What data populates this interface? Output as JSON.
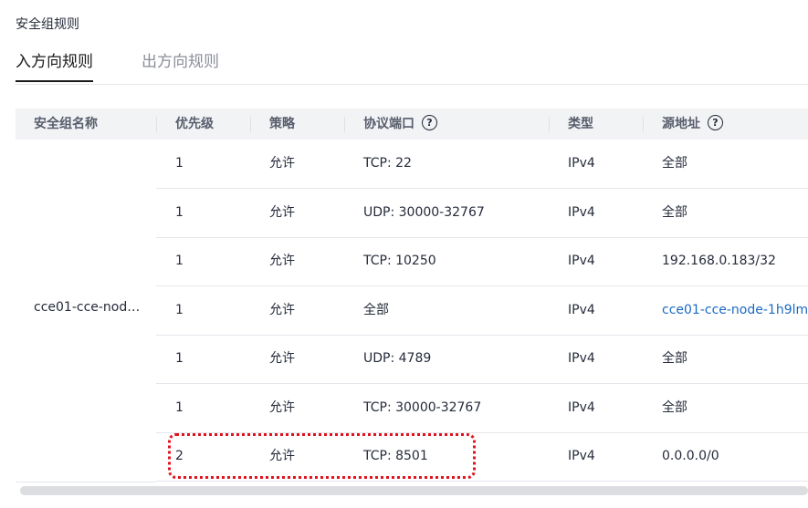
{
  "section_title": "安全组规则",
  "tabs": [
    {
      "label": "入方向规则",
      "active": true
    },
    {
      "label": "出方向规则",
      "active": false
    }
  ],
  "table": {
    "headers": {
      "group_name": "安全组名称",
      "priority": "优先级",
      "policy": "策略",
      "protocol_port": "协议端口",
      "type": "类型",
      "source": "源地址"
    },
    "group_name": "cce01-cce-nod…",
    "rows": [
      {
        "priority": "1",
        "policy": "允许",
        "port": "TCP: 22",
        "type": "IPv4",
        "source": "全部"
      },
      {
        "priority": "1",
        "policy": "允许",
        "port": "UDP: 30000-32767",
        "type": "IPv4",
        "source": "全部"
      },
      {
        "priority": "1",
        "policy": "允许",
        "port": "TCP: 10250",
        "type": "IPv4",
        "source": "192.168.0.183/32"
      },
      {
        "priority": "1",
        "policy": "允许",
        "port": "全部",
        "type": "IPv4",
        "source": "cce01-cce-node-1h9lm"
      },
      {
        "priority": "1",
        "policy": "允许",
        "port": "UDP: 4789",
        "type": "IPv4",
        "source": "全部"
      },
      {
        "priority": "1",
        "policy": "允许",
        "port": "TCP: 30000-32767",
        "type": "IPv4",
        "source": "全部"
      },
      {
        "priority": "2",
        "policy": "允许",
        "port": "TCP: 8501",
        "type": "IPv4",
        "source": "0.0.0.0/0"
      }
    ]
  },
  "icons": {
    "help": "?",
    "help_name": "help-icon"
  },
  "colors": {
    "link": "#1a6ac4",
    "highlight": "#e0121d",
    "header_bg": "#f2f3f5"
  }
}
